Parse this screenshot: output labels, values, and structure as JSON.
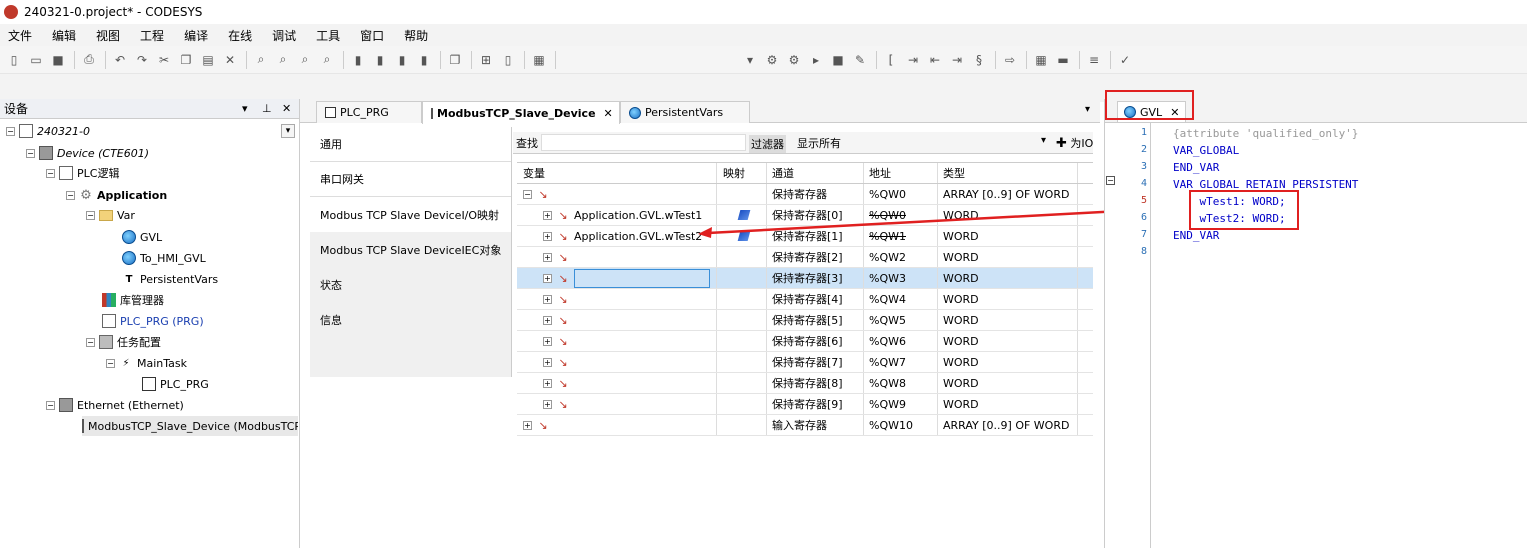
{
  "window": {
    "title": "240321-0.project* - CODESYS"
  },
  "menu": [
    "文件",
    "编辑",
    "视图",
    "工程",
    "编译",
    "在线",
    "调试",
    "工具",
    "窗口",
    "帮助"
  ],
  "devices_panel": {
    "title": "设备",
    "tree": [
      {
        "label": "240321-0",
        "toggle": "−",
        "icon": "doc"
      },
      {
        "label": "Device (CTE601)",
        "toggle": "−",
        "icon": "dev"
      },
      {
        "label": "PLC逻辑",
        "toggle": "−",
        "icon": "doc"
      },
      {
        "label": "Application",
        "toggle": "−",
        "icon": "gear"
      },
      {
        "label": "Var",
        "toggle": "−",
        "icon": "folder"
      },
      {
        "label": "GVL",
        "toggle": "",
        "icon": "globe"
      },
      {
        "label": "To_HMI_GVL",
        "toggle": "",
        "icon": "globe"
      },
      {
        "label": "PersistentVars",
        "toggle": "",
        "icon": "T"
      },
      {
        "label": "库管理器",
        "toggle": "",
        "icon": "lib"
      },
      {
        "label": "PLC_PRG (PRG)",
        "toggle": "",
        "icon": "doc"
      },
      {
        "label": "任务配置",
        "toggle": "−",
        "icon": "task"
      },
      {
        "label": "MainTask",
        "toggle": "−",
        "icon": "task"
      },
      {
        "label": "PLC_PRG",
        "toggle": "",
        "icon": "pou"
      },
      {
        "label": "Ethernet (Ethernet)",
        "toggle": "−",
        "icon": "dev"
      },
      {
        "label": "ModbusTCP_Slave_Device (ModbusTCP Slave Device)",
        "toggle": "",
        "icon": "dev"
      }
    ]
  },
  "editor_tabs": [
    {
      "label": "PLC_PRG"
    },
    {
      "label": "ModbusTCP_Slave_Device"
    },
    {
      "label": "PersistentVars"
    }
  ],
  "side_nav": [
    "通用",
    "串口网关",
    "Modbus TCP Slave DeviceI/O映射",
    "Modbus TCP Slave DeviceIEC对象",
    "状态",
    "信息"
  ],
  "find_bar": {
    "find_label": "查找",
    "filter_label": "过滤器",
    "filter_value": "显示所有",
    "add_label": "为IO"
  },
  "grid": {
    "headers": [
      "变量",
      "映射",
      "通道",
      "地址",
      "类型"
    ],
    "rows": [
      {
        "var": "",
        "chan": "保持寄存器",
        "addr": "%QW0",
        "type": "ARRAY [0..9] OF WORD",
        "strike": false
      },
      {
        "var": "Application.GVL.wTest1",
        "chan": "保持寄存器[0]",
        "addr": "%QW0",
        "type": "WORD",
        "strike": true
      },
      {
        "var": "Application.GVL.wTest2",
        "chan": "保持寄存器[1]",
        "addr": "%QW1",
        "type": "WORD",
        "strike": true
      },
      {
        "var": "",
        "chan": "保持寄存器[2]",
        "addr": "%QW2",
        "type": "WORD",
        "strike": false
      },
      {
        "var": "",
        "chan": "保持寄存器[3]",
        "addr": "%QW3",
        "type": "WORD",
        "strike": false
      },
      {
        "var": "",
        "chan": "保持寄存器[4]",
        "addr": "%QW4",
        "type": "WORD",
        "strike": false
      },
      {
        "var": "",
        "chan": "保持寄存器[5]",
        "addr": "%QW5",
        "type": "WORD",
        "strike": false
      },
      {
        "var": "",
        "chan": "保持寄存器[6]",
        "addr": "%QW6",
        "type": "WORD",
        "strike": false
      },
      {
        "var": "",
        "chan": "保持寄存器[7]",
        "addr": "%QW7",
        "type": "WORD",
        "strike": false
      },
      {
        "var": "",
        "chan": "保持寄存器[8]",
        "addr": "%QW8",
        "type": "WORD",
        "strike": false
      },
      {
        "var": "",
        "chan": "保持寄存器[9]",
        "addr": "%QW9",
        "type": "WORD",
        "strike": false
      },
      {
        "var": "",
        "chan": "输入寄存器",
        "addr": "%QW10",
        "type": "ARRAY [0..9] OF WORD",
        "strike": false
      }
    ]
  },
  "gvl": {
    "tab_label": "GVL",
    "lines": [
      {
        "n": "1",
        "text": "{attribute 'qualified_only'}"
      },
      {
        "n": "2",
        "text": "VAR_GLOBAL"
      },
      {
        "n": "3",
        "text": "END_VAR"
      },
      {
        "n": "4",
        "text": "VAR_GLOBAL RETAIN PERSISTENT"
      },
      {
        "n": "5",
        "text": "    wTest1: WORD;"
      },
      {
        "n": "6",
        "text": "    wTest2: WORD;"
      },
      {
        "n": "7",
        "text": "END_VAR"
      },
      {
        "n": "8",
        "text": ""
      }
    ]
  },
  "colors": {
    "annotation": "#e02020",
    "keyword": "#0000c8",
    "line_number": "#2b6fb5",
    "selection": "#cde3f7"
  }
}
